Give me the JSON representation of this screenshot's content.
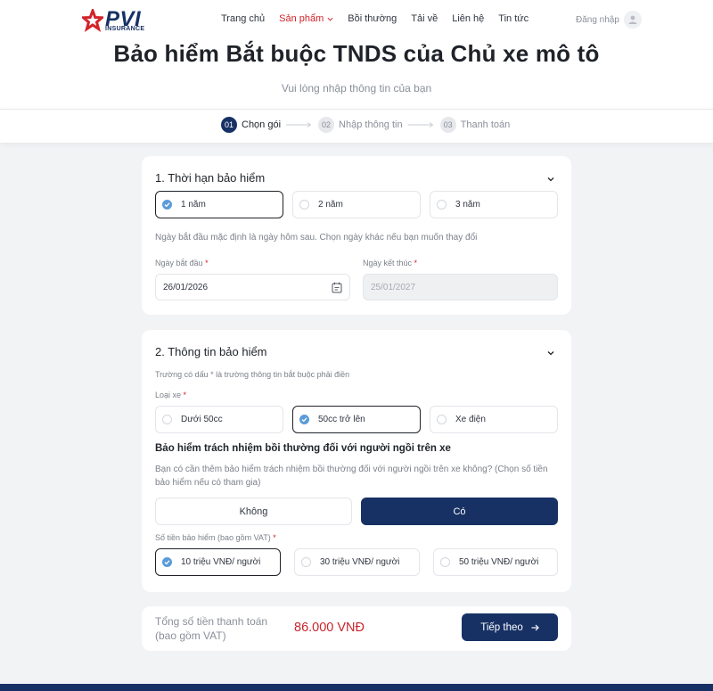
{
  "brand": {
    "name": "PVI",
    "sub": "INSURANCE",
    "primary_color": "#173165",
    "accent_color": "#d2232a"
  },
  "nav": {
    "items": [
      {
        "label": "Trang chủ"
      },
      {
        "label": "Sản phẩm"
      },
      {
        "label": "Bồi thường"
      },
      {
        "label": "Tải về"
      },
      {
        "label": "Liên hệ"
      },
      {
        "label": "Tin tức"
      }
    ],
    "login": "Đăng nhập"
  },
  "page": {
    "title": "Bảo hiểm Bắt buộc TNDS của Chủ xe mô tô",
    "subtitle": "Vui lòng nhập thông tin của bạn"
  },
  "steps": [
    {
      "num": "01",
      "label": "Chọn gói"
    },
    {
      "num": "02",
      "label": "Nhập thông tin"
    },
    {
      "num": "03",
      "label": "Thanh toán"
    }
  ],
  "section1": {
    "title": "1. Thời hạn bảo hiểm",
    "durations": [
      "1 năm",
      "2 năm",
      "3 năm"
    ],
    "selected_duration": "1 năm",
    "hint": "Ngày bắt đầu mặc định là ngày hôm sau. Chọn ngày khác nếu bạn muốn thay đổi",
    "start_label": "Ngày bắt đầu",
    "end_label": "Ngày kết thúc",
    "required_mark": "*",
    "start_value": "26/01/2026",
    "end_value": "25/01/2027"
  },
  "section2": {
    "title": "2. Thông tin bảo hiểm",
    "required_hint": "Trường có dấu * là trường thông tin bắt buộc phải điền",
    "vehicle_label": "Loại xe",
    "vehicle_types": [
      "Dưới 50cc",
      "50cc trở lên",
      "Xe điện"
    ],
    "selected_vehicle": "50cc trở lên",
    "extra_title": "Bảo hiểm trách nhiệm bồi thường đối với người ngồi trên xe",
    "extra_question": "Bạn có cần thêm bảo hiểm trách nhiệm bồi thường đối với người ngồi trên xe không? (Chọn số tiền bảo hiểm nếu có tham gia)",
    "no_label": "Không",
    "yes_label": "Có",
    "amount_label": "Số tiền bảo hiểm (bao gồm VAT)",
    "amounts": [
      "10 triệu VNĐ/ người",
      "30 triệu VNĐ/ người",
      "50 triệu VNĐ/ người"
    ],
    "selected_amount": "10 triệu VNĐ/ người"
  },
  "summary": {
    "total_label": "Tổng số tiền thanh toán (bao gồm VAT)",
    "total_value": "86.000 VNĐ",
    "next_label": "Tiếp theo"
  }
}
